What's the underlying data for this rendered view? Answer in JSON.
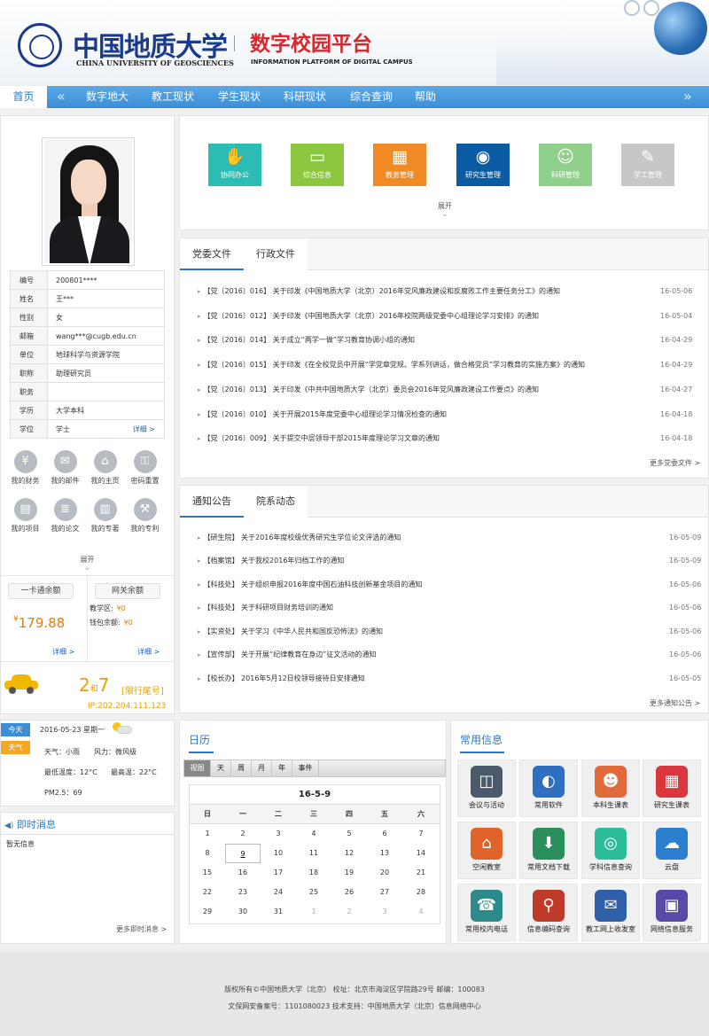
{
  "header": {
    "univ_cn": "中国地质大学",
    "univ_en": "CHINA UNIVERSITY OF GEOSCIENCES",
    "platform_cn": "数字校园平台",
    "platform_en": "INFORMATION PLATFORM OF DIGITAL CAMPUS"
  },
  "nav": {
    "home": "首页",
    "items": [
      "数字地大",
      "教工现状",
      "学生现状",
      "科研现状",
      "综合查询",
      "帮助"
    ]
  },
  "profile": {
    "rows": [
      {
        "k": "编号",
        "v": "200801****"
      },
      {
        "k": "姓名",
        "v": "王***"
      },
      {
        "k": "性别",
        "v": "女"
      },
      {
        "k": "邮箱",
        "v": "wang***@cugb.edu.cn"
      },
      {
        "k": "单位",
        "v": "地球科学与资源学院"
      },
      {
        "k": "职称",
        "v": "助理研究员"
      },
      {
        "k": "职务",
        "v": ""
      },
      {
        "k": "学历",
        "v": "大学本科"
      },
      {
        "k": "学位",
        "v": "学士"
      }
    ],
    "detail": "详细 >",
    "links": [
      {
        "label": "我的财务",
        "icon": "money-bag-icon",
        "g": "¥"
      },
      {
        "label": "我的邮件",
        "icon": "envelope-icon",
        "g": "✉"
      },
      {
        "label": "我的主页",
        "icon": "home-icon",
        "g": "⌂"
      },
      {
        "label": "密码重置",
        "icon": "lock-icon",
        "g": "⚿"
      },
      {
        "label": "我的项目",
        "icon": "briefcase-icon",
        "g": "▤"
      },
      {
        "label": "我的论文",
        "icon": "document-icon",
        "g": "≣"
      },
      {
        "label": "我的专著",
        "icon": "books-icon",
        "g": "▥"
      },
      {
        "label": "我的专利",
        "icon": "wrench-icon",
        "g": "⚒"
      }
    ],
    "expand": "展开",
    "card": {
      "label": "一卡通余额",
      "amount": "179.88",
      "currency": "¥",
      "detail": "详细 >"
    },
    "net": {
      "label": "网关余额",
      "campus_label": "教学区:",
      "campus_value": "¥0",
      "wallet_label": "钱包余额:",
      "wallet_value": "¥0",
      "detail": "详细 >"
    },
    "traffic": {
      "n1": "2",
      "and": "和",
      "n2": "7",
      "restrict": "[限行尾号]",
      "ip": "IP:202.204.111.123"
    }
  },
  "apps": {
    "items": [
      {
        "label": "协同办公",
        "color": "#2bbdb5",
        "g": "✋"
      },
      {
        "label": "综合信息",
        "color": "#8dc63f",
        "g": "▭"
      },
      {
        "label": "教务管理",
        "color": "#f08a24",
        "g": "▦"
      },
      {
        "label": "研究生管理",
        "color": "#0b5ba3",
        "g": "◉"
      },
      {
        "label": "科研管理",
        "color": "#8fd18b",
        "g": "☺"
      },
      {
        "label": "学工管理",
        "color": "#c7c7c7",
        "g": "✎"
      }
    ],
    "expand": "展开"
  },
  "party": {
    "tabs": [
      "党委文件",
      "行政文件"
    ],
    "rows": [
      {
        "t": "【党〔2016〕016】 关于印发《中国地质大学（北京）2016年党风廉政建设和反腐败工作主要任务分工》的通知",
        "d": "16-05-06"
      },
      {
        "t": "【党〔2016〕012】 关于印发《中国地质大学（北京）2016年校院两级党委中心组理论学习安排》的通知",
        "d": "16-05-04"
      },
      {
        "t": "【党〔2016〕014】 关于成立“两学一做”学习教育协调小组的通知",
        "d": "16-04-29"
      },
      {
        "t": "【党〔2016〕015】 关于印发《在全校党员中开展“学党章党规、学系列讲话，做合格党员”学习教育的实施方案》的通知",
        "d": "16-04-29"
      },
      {
        "t": "【党〔2016〕013】 关于印发《中共中国地质大学（北京）委员会2016年党风廉政建设工作要点》的通知",
        "d": "16-04-27"
      },
      {
        "t": "【党〔2016〕010】 关于开展2015年度党委中心组理论学习情况检查的通知",
        "d": "16-04-18"
      },
      {
        "t": "【党〔2016〕009】 关于提交中层领导干部2015年度理论学习文章的通知",
        "d": "16-04-18"
      }
    ],
    "more": "更多党委文件 >"
  },
  "notice": {
    "tabs": [
      "通知公告",
      "院系动态"
    ],
    "rows": [
      {
        "t": "【研生院】 关于2016年度校级优秀研究生学位论文评选的通知",
        "d": "16-05-09"
      },
      {
        "t": "【档案馆】 关于我校2016年归档工作的通知",
        "d": "16-05-09"
      },
      {
        "t": "【科技处】 关于组织申报2016年度中国石油科技创新基金项目的通知",
        "d": "16-05-06"
      },
      {
        "t": "【科技处】 关于科研项目财务培训的通知",
        "d": "16-05-06"
      },
      {
        "t": "【实资处】 关于学习《中华人民共和国反恐怖法》的通知",
        "d": "16-05-06"
      },
      {
        "t": "【宣传部】 关于开展“纪律教育在身边”征文活动的通知",
        "d": "16-05-06"
      },
      {
        "t": "【校长办】 2016年5月12日校领导接待日安排通知",
        "d": "16-05-05"
      }
    ],
    "more": "更多通知公告 >"
  },
  "weather": {
    "today_tag": "今天",
    "weather_tag": "天气",
    "date": "2016-05-23 星期一",
    "cond": "天气：小雨",
    "wind": "风力：微风级",
    "low": "最低温度：12°C",
    "high": "最高温：22°C",
    "pm": "PM2.5：69"
  },
  "messages": {
    "title": "即时消息",
    "empty": "暂无信息",
    "more": "更多即时消息 >"
  },
  "calendar": {
    "title": "日历",
    "buttons": [
      "视图",
      "天",
      "周",
      "月",
      "年",
      "事件"
    ],
    "heading": "16-5-9",
    "weekdays": [
      "日",
      "一",
      "二",
      "三",
      "四",
      "五",
      "六"
    ],
    "weeks": [
      [
        "1",
        "2",
        "3",
        "4",
        "5",
        "6",
        "7"
      ],
      [
        "8",
        "9",
        "10",
        "11",
        "12",
        "13",
        "14"
      ],
      [
        "15",
        "16",
        "17",
        "18",
        "19",
        "20",
        "21"
      ],
      [
        "22",
        "23",
        "24",
        "25",
        "26",
        "27",
        "28"
      ],
      [
        "29",
        "30",
        "31",
        "1",
        "2",
        "3",
        "4"
      ]
    ],
    "today": "9"
  },
  "common": {
    "title": "常用信息",
    "items": [
      {
        "label": "会议与活动",
        "color": "#4a5a6a",
        "g": "◫"
      },
      {
        "label": "常用软件",
        "color": "#2f6fc0",
        "g": "◐"
      },
      {
        "label": "本科生课表",
        "color": "#e06a3a",
        "g": "☻"
      },
      {
        "label": "研究生课表",
        "color": "#d9363e",
        "g": "▦"
      },
      {
        "label": "空闲教室",
        "color": "#e0632a",
        "g": "⌂"
      },
      {
        "label": "常用文档下载",
        "color": "#2a8f5a",
        "g": "⬇"
      },
      {
        "label": "学科信息查询",
        "color": "#2bbd9a",
        "g": "◎"
      },
      {
        "label": "云盘",
        "color": "#2b7fd0",
        "g": "☁"
      },
      {
        "label": "常用校内电话",
        "color": "#2d8a8a",
        "g": "☎"
      },
      {
        "label": "信息编码查询",
        "color": "#c03a2a",
        "g": "⚲"
      },
      {
        "label": "教工网上收发室",
        "color": "#2f5fa8",
        "g": "✉"
      },
      {
        "label": "网络信息服务",
        "color": "#5a4aa8",
        "g": "▣"
      }
    ]
  },
  "footer": {
    "line1": "版权所有©中国地质大学（北京） 校址：北京市海淀区学院路29号 邮编：100083",
    "line2": "文保网安备案号：1101080023    技术支持：中国地质大学（北京）信息网络中心"
  }
}
